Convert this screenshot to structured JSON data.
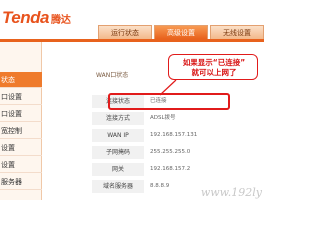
{
  "header": {
    "logo_text": "Tenda",
    "logo_cn": "腾达",
    "tabs": [
      {
        "label": "运行状态"
      },
      {
        "label": "高级设置"
      },
      {
        "label": "无线设置"
      }
    ]
  },
  "sidebar": {
    "items": [
      {
        "label": "状态"
      },
      {
        "label": "口设置"
      },
      {
        "label": "口设置"
      },
      {
        "label": "宽控制"
      },
      {
        "label": "设置"
      },
      {
        "label": "设置"
      },
      {
        "label": "服务器"
      }
    ]
  },
  "main": {
    "section_title": "WAN口状态",
    "rows": [
      {
        "label": "连接状态",
        "value": "已连接"
      },
      {
        "label": "连接方式",
        "value": "ADSL拨号"
      },
      {
        "label": "WAN IP",
        "value": "192.168.157.131"
      },
      {
        "label": "子网掩码",
        "value": "255.255.255.0"
      },
      {
        "label": "网关",
        "value": "192.168.157.2"
      },
      {
        "label": "域名服务器",
        "value": "8.8.8.9"
      }
    ]
  },
  "callout": {
    "line1": "如果显示“已连接”",
    "line2": "就可以上网了"
  },
  "watermark": "www.192ly"
}
